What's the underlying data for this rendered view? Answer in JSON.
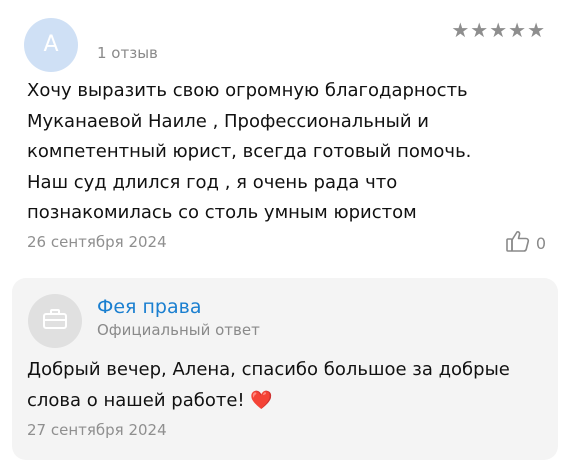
{
  "review": {
    "avatar_letter": "A",
    "author_name": "",
    "review_count": "1 отзыв",
    "stars": "★★★★★",
    "rating": 5,
    "text_lines": [
      "Хочу выразить свою огромную благодарность",
      "Муканаевой Наиле , Профессиональный и",
      "компетентный юрист, всегда готовый помочь.",
      "Наш суд длился год , я очень рада что",
      "познакомилась со столь умным юристом"
    ],
    "date": "26 сентября 2024",
    "likes": "0"
  },
  "reply": {
    "company_name": "Фея права",
    "label": "Официальный ответ",
    "text_lines": [
      "Добрый вечер, Алена, спасибо большое за добрые",
      "слова о нашей работе!"
    ],
    "heart": "❤️",
    "date": "27 сентября 2024"
  },
  "colors": {
    "accent": "#1a7fd0",
    "avatar_bg": "#cfe0f5",
    "reply_bg": "#f4f4f4",
    "heart": "#e0245e"
  },
  "icons": {
    "like": "thumbs-up-icon",
    "company": "briefcase-icon"
  }
}
